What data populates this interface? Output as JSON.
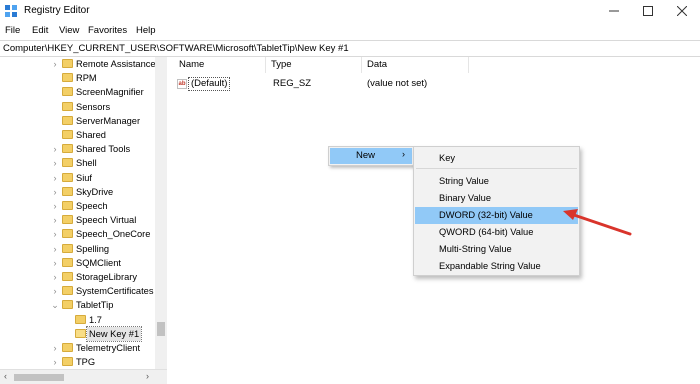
{
  "window": {
    "title": "Registry Editor",
    "minimize": "—",
    "maximize": "☐",
    "close": "✕"
  },
  "menu": [
    "File",
    "Edit",
    "View",
    "Favorites",
    "Help"
  ],
  "address": "Computer\\HKEY_CURRENT_USER\\SOFTWARE\\Microsoft\\TabletTip\\New Key #1",
  "tree": [
    {
      "label": "Remote Assistance",
      "expandable": true
    },
    {
      "label": "RPM",
      "expandable": false
    },
    {
      "label": "ScreenMagnifier",
      "expandable": false
    },
    {
      "label": "Sensors",
      "expandable": false
    },
    {
      "label": "ServerManager",
      "expandable": false
    },
    {
      "label": "Shared",
      "expandable": false
    },
    {
      "label": "Shared Tools",
      "expandable": true
    },
    {
      "label": "Shell",
      "expandable": true
    },
    {
      "label": "Siuf",
      "expandable": true
    },
    {
      "label": "SkyDrive",
      "expandable": true
    },
    {
      "label": "Speech",
      "expandable": true
    },
    {
      "label": "Speech Virtual",
      "expandable": true
    },
    {
      "label": "Speech_OneCore",
      "expandable": true
    },
    {
      "label": "Spelling",
      "expandable": true
    },
    {
      "label": "SQMClient",
      "expandable": true
    },
    {
      "label": "StorageLibrary",
      "expandable": true
    },
    {
      "label": "SystemCertificates",
      "expandable": true
    },
    {
      "label": "TabletTip",
      "expandable": true,
      "expanded": true
    },
    {
      "label": "1.7",
      "expandable": false,
      "child": true
    },
    {
      "label": "New Key #1",
      "expandable": false,
      "child": true,
      "selected": true
    },
    {
      "label": "TelemetryClient",
      "expandable": true
    },
    {
      "label": "TPG",
      "expandable": true
    }
  ],
  "columns": [
    "Name",
    "Type",
    "Data"
  ],
  "values": [
    {
      "icon_text": "ab",
      "name": "(Default)",
      "type": "REG_SZ",
      "data": "(value not set)"
    }
  ],
  "context_menu": {
    "new_label": "New",
    "new_arrow": "›",
    "submenu": [
      {
        "label": "Key"
      },
      {
        "label": "String Value"
      },
      {
        "label": "Binary Value"
      },
      {
        "label": "DWORD (32-bit) Value",
        "highlighted": true
      },
      {
        "label": "QWORD (64-bit) Value"
      },
      {
        "label": "Multi-String Value"
      },
      {
        "label": "Expandable String Value"
      }
    ]
  },
  "colors": {
    "highlight": "#91c9f7",
    "folder": "#f3cf66",
    "annotation_arrow": "#d9342b"
  }
}
